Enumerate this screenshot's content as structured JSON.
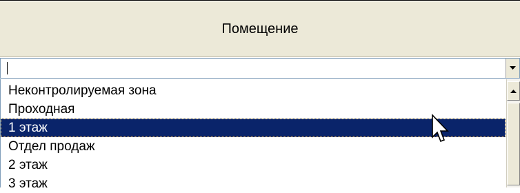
{
  "header": {
    "column_title": "Помещение"
  },
  "combo": {
    "value": ""
  },
  "dropdown": {
    "items": [
      {
        "label": "Неконтролируемая зона",
        "selected": false
      },
      {
        "label": "Проходная",
        "selected": false
      },
      {
        "label": "1 этаж",
        "selected": true
      },
      {
        "label": "Отдел продаж",
        "selected": false
      },
      {
        "label": "2 этаж",
        "selected": false
      },
      {
        "label": "3 этаж",
        "selected": false
      }
    ]
  },
  "icons": {
    "combo_button": "chevron-down-icon",
    "scroll_up": "arrow-up-icon",
    "cursor": "mouse-pointer-icon"
  },
  "colors": {
    "header_bg": "#ece9d8",
    "selection_bg": "#0a246a",
    "selection_text": "#ffffff"
  }
}
